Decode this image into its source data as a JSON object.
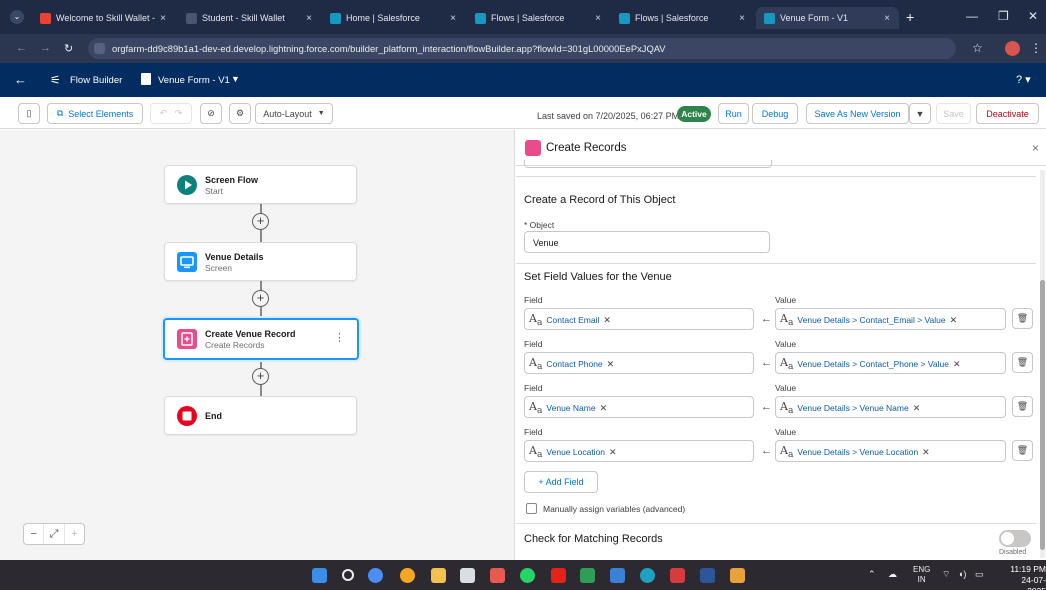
{
  "browser": {
    "tabs": [
      {
        "title": "Welcome to Skill Wallet - /",
        "favicon_color": "#ea4335"
      },
      {
        "title": "Student - Skill Wallet",
        "favicon_color": "#4a5670"
      },
      {
        "title": "Home | Salesforce",
        "favicon_color": "#1798c1"
      },
      {
        "title": "Flows | Salesforce",
        "favicon_color": "#1798c1"
      },
      {
        "title": "Flows | Salesforce",
        "favicon_color": "#1798c1"
      },
      {
        "title": "Venue Form - V1",
        "favicon_color": "#1798c1"
      }
    ],
    "tab_close": "×",
    "new_tab": "+",
    "url": "orgfarm-dd9c89b1a1-dev-ed.develop.lightning.force.com/builder_platform_interaction/flowBuilder.app?flowId=301gL00000EePxJQAV"
  },
  "app": {
    "back_icon": "←",
    "app_name": "Flow Builder",
    "flow_name": "Venue Form - V1",
    "dropdown_icon": "▼",
    "help_icon": "?",
    "header_color": "#032d60"
  },
  "toolbar": {
    "select_elements": "Select Elements",
    "layout": "Auto-Layout",
    "last_saved": "Last saved on 7/20/2025, 06:27 PM",
    "status": "Active",
    "run": "Run",
    "debug": "Debug",
    "save_as_new": "Save As New Version",
    "save": "Save",
    "deactivate": "Deactivate"
  },
  "canvas": {
    "nodes": [
      {
        "title": "Screen Flow",
        "subtitle": "Start",
        "icon": "play-icon",
        "color": "#0b827c"
      },
      {
        "title": "Venue Details",
        "subtitle": "Screen",
        "icon": "screen-icon",
        "color": "#1b96ff"
      },
      {
        "title": "Create Venue Record",
        "subtitle": "Create Records",
        "icon": "create-records-icon",
        "color": "#ea4b8b"
      },
      {
        "title": "End",
        "subtitle": "",
        "icon": "stop-icon",
        "color": "#ea001e"
      }
    ],
    "zoom": {
      "out": "−",
      "fit": "⤢",
      "in": "+"
    }
  },
  "panel": {
    "title": "Create Records",
    "close_icon": "×",
    "section_object": "Create a Record of This Object",
    "object_label": "* Object",
    "object_value": "Venue",
    "section_fields": "Set Field Values for the Venue",
    "field_col": "Field",
    "value_col": "Value",
    "rows": [
      {
        "field": "Contact Email",
        "value": "Venue Details > Contact_Email > Value"
      },
      {
        "field": "Contact Phone",
        "value": "Venue Details > Contact_Phone > Value"
      },
      {
        "field": "Venue Name",
        "value": "Venue Details > Venue Name"
      },
      {
        "field": "Venue Location",
        "value": "Venue Details > Venue Location"
      }
    ],
    "add_field": "+ Add Field",
    "manual_assign": "Manually assign variables (advanced)",
    "section_matching": "Check for Matching Records",
    "toggle_state": "Disabled"
  },
  "taskbar": {
    "lang": "ENG",
    "region": "IN",
    "time": "11:19 PM",
    "date": "24-07-2025"
  }
}
